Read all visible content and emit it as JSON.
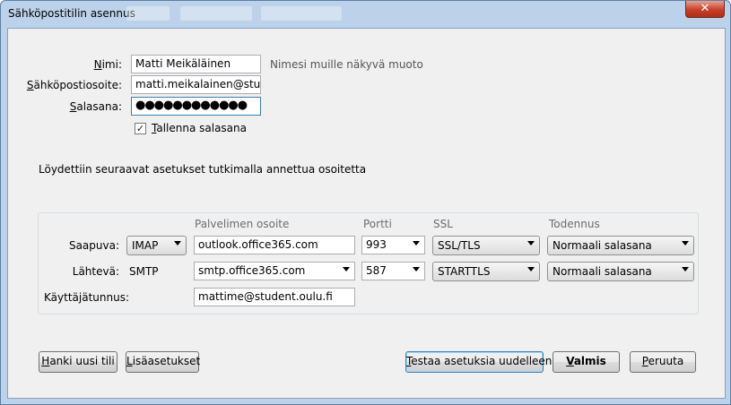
{
  "window": {
    "title": "Sähköpostitilin asennus"
  },
  "account": {
    "name_label": "Nimi:",
    "name_value": "Matti Meikäläinen",
    "name_hint": "Nimesi muille näkyvä muoto",
    "email_label": "Sähköpostiosoite:",
    "email_value": "matti.meikalainen@student.oulu.fi",
    "password_label": "Salasana:",
    "password_value": "●●●●●●●●●●●●",
    "remember_label": "Tallenna salasana",
    "remember_checked": true
  },
  "message": "Löydettiin seuraavat asetukset tutkimalla annettua osoitetta",
  "settings": {
    "headers": {
      "server": "Palvelimen osoite",
      "port": "Portti",
      "ssl": "SSL",
      "auth": "Todennus"
    },
    "incoming": {
      "label": "Saapuva:",
      "protocol": "IMAP",
      "server": "outlook.office365.com",
      "port": "993",
      "ssl": "SSL/TLS",
      "auth": "Normaali salasana"
    },
    "outgoing": {
      "label": "Lähtevä:",
      "protocol": "SMTP",
      "server": "smtp.office365.com",
      "port": "587",
      "ssl": "STARTTLS",
      "auth": "Normaali salasana"
    },
    "username": {
      "label": "Käyttäjätunnus:",
      "value": "mattime@student.oulu.fi"
    }
  },
  "buttons": {
    "new_account": "Hanki uusi tili",
    "advanced": "Lisäasetukset",
    "retest": "Testaa asetuksia uudelleen",
    "done": "Valmis",
    "cancel": "Peruuta"
  },
  "icons": {
    "close": "close-icon",
    "check": "check-icon",
    "dropdown": "chevron-down-icon"
  },
  "colors": {
    "titlebar": "#bcd2ea",
    "dialog": "#f0f0f0",
    "close_button": "#c7402a"
  }
}
